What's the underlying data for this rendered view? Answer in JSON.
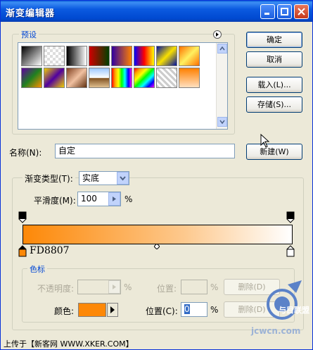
{
  "window": {
    "title": "渐变编辑器"
  },
  "presets": {
    "legend": "预设",
    "swatches": [
      {
        "name": "black-white",
        "bg": "linear-gradient(135deg,#000,#fff)"
      },
      {
        "name": "transparent-checker",
        "bg": "repeating-conic-gradient(#ddd 0 25%, #fff 0 50%) 0 0/8px 8px"
      },
      {
        "name": "black-white-2",
        "bg": "linear-gradient(to right,#000,#fff)"
      },
      {
        "name": "red-green",
        "bg": "linear-gradient(to right,#d00000,#004000)"
      },
      {
        "name": "violet-orange",
        "bg": "linear-gradient(to right,#3000a0,#ff8000)"
      },
      {
        "name": "blue-red-yellow",
        "bg": "linear-gradient(to right,#0000ff,#ff0000,#ffff00)"
      },
      {
        "name": "blue-yellow-blue",
        "bg": "linear-gradient(135deg,#0010a0,#f8e000,#0010a0)"
      },
      {
        "name": "orange-yellow-orange",
        "bg": "linear-gradient(135deg,#ff7000,#fff060,#ff7000)"
      },
      {
        "name": "violet-green-orange",
        "bg": "linear-gradient(135deg,#6000a0,#208020,#ff9000)"
      },
      {
        "name": "yellow-violet",
        "bg": "linear-gradient(135deg,#f0d000,#5000a0,#f0d000)"
      },
      {
        "name": "copper",
        "bg": "linear-gradient(135deg,#804020,#f0c0a0,#603010)"
      },
      {
        "name": "chrome",
        "bg": "linear-gradient(to bottom,#9cc8ff,#ffffff 50%,#805020 52%,#e0c090)"
      },
      {
        "name": "spectrum",
        "bg": "linear-gradient(to right,red,orange,yellow,lime,cyan,blue,magenta)"
      },
      {
        "name": "transparent-rainbow",
        "bg": "linear-gradient(135deg,red,orange,yellow,lime,cyan,blue,magenta)"
      },
      {
        "name": "transparent-stripes",
        "bg": "repeating-linear-gradient(45deg,#ccc 0 3px,#fff 3px 6px)"
      },
      {
        "name": "orange-white",
        "bg": "linear-gradient(to bottom,#ff8000,#ffe0c0)"
      }
    ]
  },
  "buttons": {
    "ok": "确定",
    "cancel": "取消",
    "load": "载入(L)...",
    "save": "存储(S)...",
    "new": "新建(W)"
  },
  "name": {
    "label": "名称(N):",
    "value": "自定"
  },
  "gradient_type": {
    "legend": "渐变类型(T):",
    "value": "实底"
  },
  "smoothness": {
    "label": "平滑度(M):",
    "value": "100",
    "unit": "%"
  },
  "editor": {
    "color_stop_readout": "FD8807",
    "start_color": "#fd8807",
    "end_color": "#ffffff"
  },
  "color_stops": {
    "legend": "色标",
    "opacity_label": "不透明度:",
    "opacity_unit": "%",
    "position_label_top": "位置:",
    "position_unit_top": "%",
    "delete_top": "删除(D)",
    "color_label": "颜色:",
    "color_swatch": "#fd8807",
    "position_label": "位置(C):",
    "position_value": "0",
    "position_unit": "%",
    "delete": "删除(D)"
  },
  "footer": {
    "text": "上传于【新客网 WWW.XKER.COM】"
  },
  "watermark": {
    "text": "jcwcn.com",
    "brand": "与目联盟"
  }
}
